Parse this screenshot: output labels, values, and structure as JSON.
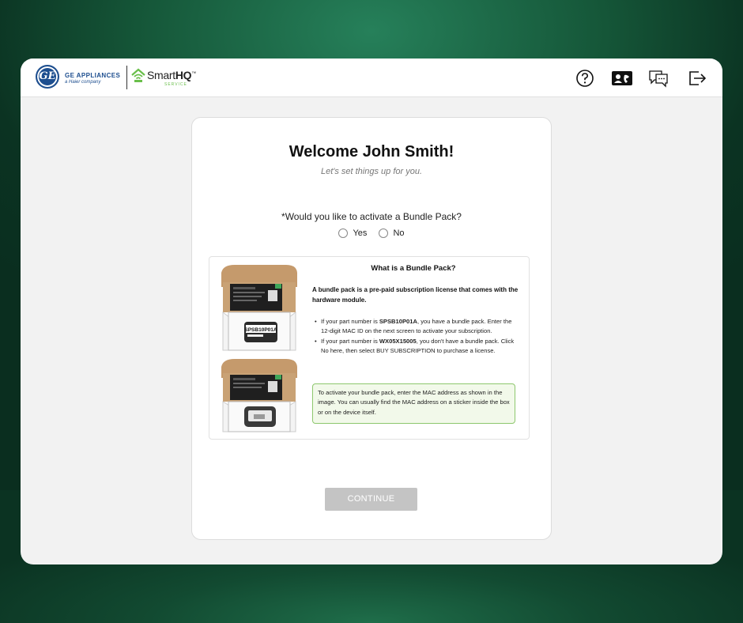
{
  "header": {
    "ge_logo_text": "GE",
    "brand_line1": "GE APPLIANCES",
    "brand_line2": "a Haier company",
    "smarthq_prefix": "Smart",
    "smarthq_bold": "HQ",
    "smarthq_tm": "™",
    "smarthq_sub": "SERVICE",
    "icons": [
      "help-icon",
      "contact-card-icon",
      "support-chat-icon",
      "logout-icon"
    ]
  },
  "main": {
    "welcome": "Welcome John Smith!",
    "subtitle": "Let's set things up for you.",
    "question": "*Would you like to activate a Bundle Pack?",
    "option_yes": "Yes",
    "option_no": "No",
    "continue_label": "CONTINUE"
  },
  "info": {
    "title": "What is a Bundle Pack?",
    "intro": "A bundle pack is a pre-paid subscription license that comes with the hardware module.",
    "bullet1_pre": "If your part number is ",
    "bullet1_part": "SPSB10P01A",
    "bullet1_post": ", you have a bundle pack. Enter the 12-digit MAC ID on the next screen to activate your subscription.",
    "bullet2_pre": "If your part number is ",
    "bullet2_part": "WX05X15005",
    "bullet2_post": ", you don't have a bundle pack. Click No here, then select BUY SUBSCRIPTION to purchase a license.",
    "note": "To activate your bundle pack, enter the MAC address as shown in the image. You can usually find the MAC address on a sticker inside the box or on the device itself.",
    "box_label_1": "SPSB10P01A"
  },
  "colors": {
    "brand_blue": "#1d4e8f",
    "smarthq_green": "#6abf4b",
    "note_border": "#8dc76d",
    "button_disabled": "#c4c4c4"
  }
}
